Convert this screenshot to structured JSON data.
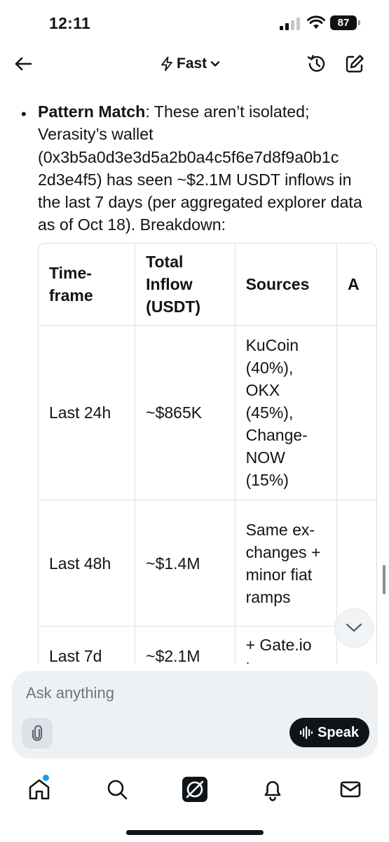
{
  "status_bar": {
    "time": "12:11",
    "battery": "87"
  },
  "header": {
    "mode_label": "Fast"
  },
  "message": {
    "bold_lead": "Pattern Match",
    "text": ": These aren’t isolated; Verasity’s wallet (0x3b5a0d3e3d5a2b0a4c5f6e7d8f9a0b1c 2d3e4f5) has seen ~$2.1M USDT inflows in the last 7 days (per aggregated explorer data as of Oct 18). Breakdown:"
  },
  "table": {
    "headers": [
      "Time-\nframe",
      "Total\nInflow\n(USDT)",
      "Sources",
      "A"
    ],
    "rows": [
      {
        "timeframe": "Last 24h",
        "inflow": "~$865K",
        "sources": "KuCoin (40%), OKX (45%), Change-NOW (15%)"
      },
      {
        "timeframe": "Last 48h",
        "inflow": "~$1.4M",
        "sources": "Same ex-changes + minor fiat ramps"
      },
      {
        "timeframe": "Last 7d",
        "inflow": "~$2.1M",
        "sources": "+ Gate.io traces"
      }
    ]
  },
  "composer": {
    "placeholder": "Ask anything",
    "speak_label": "Speak"
  },
  "tabs": [
    "home",
    "search",
    "grok",
    "notifications",
    "messages"
  ]
}
